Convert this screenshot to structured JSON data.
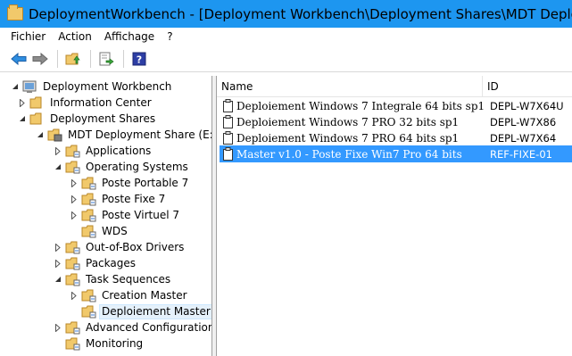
{
  "window": {
    "title": "DeploymentWorkbench - [Deployment Workbench\\Deployment Shares\\MDT Deployment Sh"
  },
  "menu": [
    "Fichier",
    "Action",
    "Affichage",
    "?"
  ],
  "toolbar": {
    "icons": [
      "back-arrow-icon",
      "forward-arrow-icon",
      "up-folder-icon",
      "export-icon",
      "help-icon"
    ]
  },
  "tree": [
    {
      "label": "Deployment Workbench",
      "level": 0,
      "expander": "expanded",
      "icon": "workbench-icon"
    },
    {
      "label": "Information Center",
      "level": 1,
      "expander": "collapsed",
      "icon": "folder-icon"
    },
    {
      "label": "Deployment Shares",
      "level": 1,
      "expander": "expanded",
      "icon": "folder-icon"
    },
    {
      "label": "MDT Deployment Share (E:\\De",
      "level": 2,
      "expander": "expanded",
      "icon": "share-icon"
    },
    {
      "label": "Applications",
      "level": 3,
      "expander": "collapsed",
      "icon": "folder-icon"
    },
    {
      "label": "Operating Systems",
      "level": 3,
      "expander": "expanded",
      "icon": "folder-icon"
    },
    {
      "label": "Poste Portable 7",
      "level": 4,
      "expander": "collapsed",
      "icon": "folder-icon"
    },
    {
      "label": "Poste Fixe 7",
      "level": 4,
      "expander": "collapsed",
      "icon": "folder-icon"
    },
    {
      "label": "Poste Virtuel 7",
      "level": 4,
      "expander": "collapsed",
      "icon": "folder-icon"
    },
    {
      "label": "WDS",
      "level": 4,
      "expander": "none",
      "icon": "folder-icon"
    },
    {
      "label": "Out-of-Box Drivers",
      "level": 3,
      "expander": "collapsed",
      "icon": "folder-icon"
    },
    {
      "label": "Packages",
      "level": 3,
      "expander": "collapsed",
      "icon": "folder-icon"
    },
    {
      "label": "Task Sequences",
      "level": 3,
      "expander": "expanded",
      "icon": "folder-icon"
    },
    {
      "label": "Creation Master",
      "level": 4,
      "expander": "collapsed",
      "icon": "folder-icon"
    },
    {
      "label": "Deploiement Master",
      "level": 4,
      "expander": "none",
      "icon": "folder-icon",
      "selected": true
    },
    {
      "label": "Advanced Configuration",
      "level": 3,
      "expander": "collapsed",
      "icon": "folder-icon"
    },
    {
      "label": "Monitoring",
      "level": 3,
      "expander": "none",
      "icon": "folder-icon"
    }
  ],
  "list": {
    "columns": [
      "Name",
      "ID"
    ],
    "rows": [
      {
        "name": "Deploiement Windows 7 Integrale 64 bits sp1",
        "id": "DEPL-W7X64U"
      },
      {
        "name": "Deploiement Windows 7 PRO 32 bits sp1",
        "id": "DEPL-W7X86"
      },
      {
        "name": "Deploiement Windows 7 PRO 64  bits sp1",
        "id": "DEPL-W7X64"
      },
      {
        "name": "Master v1.0 - Poste Fixe Win7 Pro 64 bits",
        "id": "REF-FIXE-01",
        "selected": true
      }
    ]
  },
  "colors": {
    "titlebar": "#1d96f0",
    "selection": "#3399ff",
    "tree_selection": "#e5f1fb",
    "folder": "#f1c96b"
  }
}
